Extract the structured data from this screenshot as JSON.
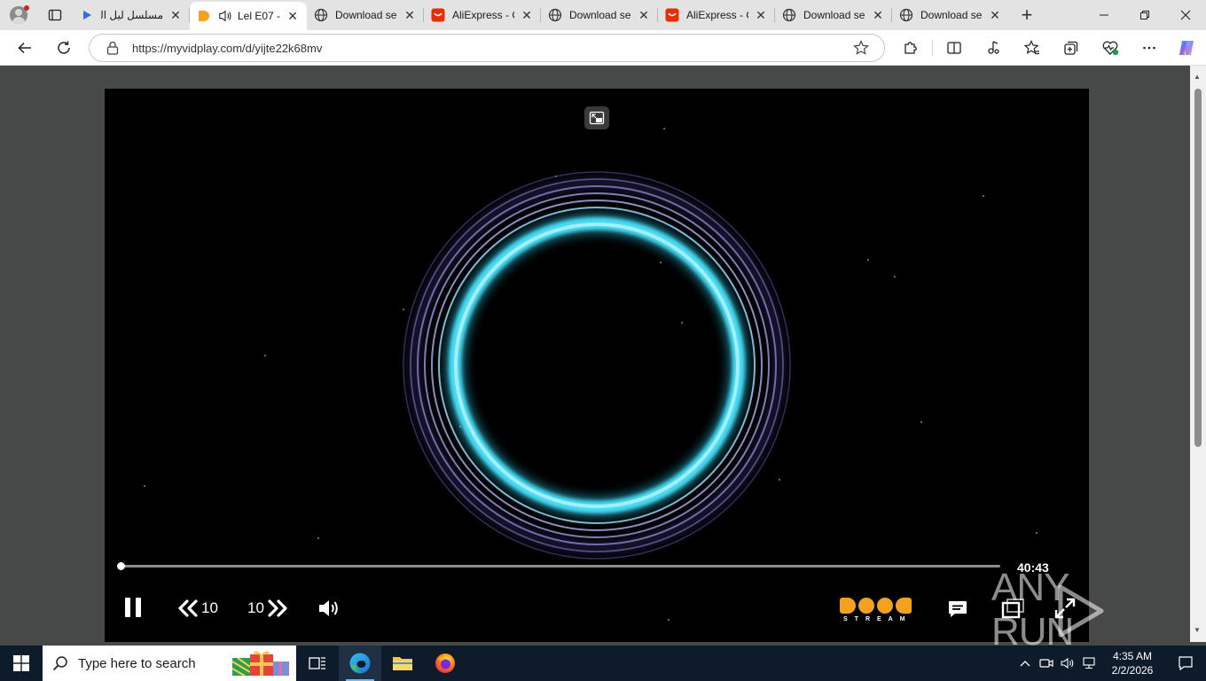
{
  "browser": {
    "tabs": [
      {
        "title": "مسلسل ليل الـ",
        "favicon": "play-icon",
        "active": false
      },
      {
        "title": "Lel E07 -",
        "favicon": "doodstream-icon",
        "active": true,
        "audio": true
      },
      {
        "title": "Download se",
        "favicon": "globe-icon",
        "active": false
      },
      {
        "title": "AliExpress - C",
        "favicon": "aliexpress-icon",
        "active": false
      },
      {
        "title": "Download se",
        "favicon": "globe-icon",
        "active": false
      },
      {
        "title": "AliExpress - C",
        "favicon": "aliexpress-icon",
        "active": false
      },
      {
        "title": "Download se",
        "favicon": "globe-icon",
        "active": false
      },
      {
        "title": "Download se",
        "favicon": "globe-icon",
        "active": false
      }
    ],
    "url": "https://myvidplay.com/d/yijte22k68mv"
  },
  "player": {
    "duration": "40:43",
    "progress": 0.0,
    "rewind_seconds": "10",
    "forward_seconds": "10",
    "brand_word": "STREAM",
    "colors": {
      "brand": "#f4a11f",
      "ring": "#3fd6f2"
    }
  },
  "watermark": {
    "text": "ANY RUN"
  },
  "taskbar": {
    "search_placeholder": "Type here to search",
    "time": "4:35 AM",
    "date": "2/2/2026"
  }
}
